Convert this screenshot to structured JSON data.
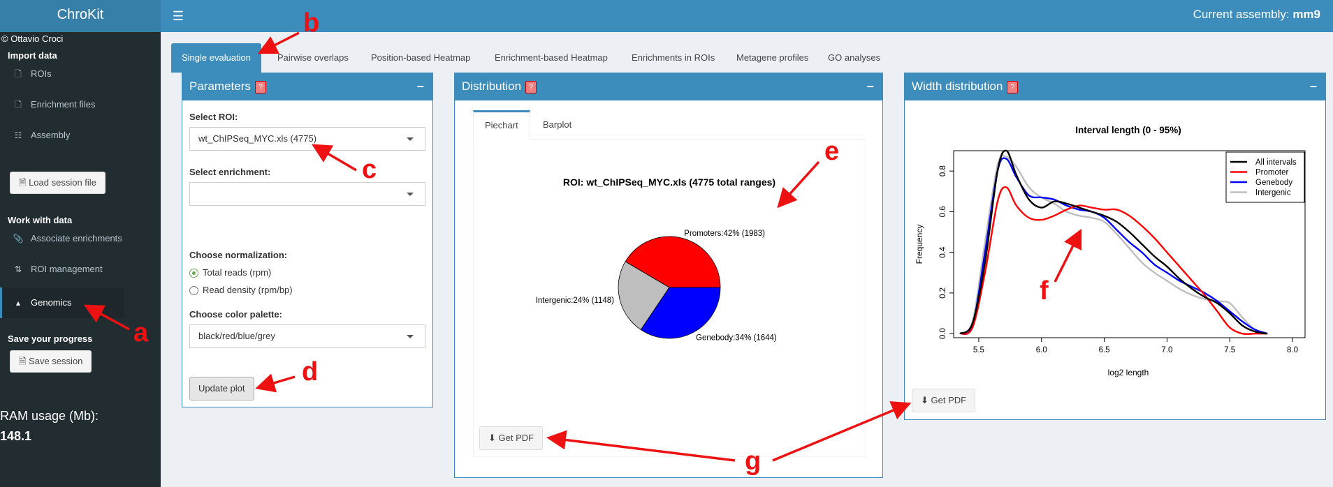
{
  "header": {
    "logo": "ChroKit",
    "assembly_label": "Current assembly:",
    "assembly_value": "mm9"
  },
  "sidebar": {
    "copyright": "© Ottavio Croci",
    "import_header": "Import data",
    "items_import": [
      "ROIs",
      "Enrichment files",
      "Assembly"
    ],
    "load_session": "Load session file",
    "work_header": "Work with data",
    "items_work": [
      "Associate enrichments",
      "ROI management",
      "Genomics"
    ],
    "save_header": "Save your progress",
    "save_session": "Save session",
    "ram_label": "RAM usage (Mb):",
    "ram_value": "148.1"
  },
  "tabs": [
    "Single evaluation",
    "Pairwise overlaps",
    "Position-based Heatmap",
    "Enrichment-based Heatmap",
    "Enrichments in ROIs",
    "Metagene profiles",
    "GO analyses"
  ],
  "parameters": {
    "title": "Parameters",
    "qmark": "?",
    "select_roi_label": "Select ROI:",
    "select_roi_value": "wt_ChIPSeq_MYC.xls (4775)",
    "select_enrichment_label": "Select enrichment:",
    "select_enrichment_value": "",
    "normalization_label": "Choose normalization:",
    "normalization_options": [
      "Total reads (rpm)",
      "Read density (rpm/bp)"
    ],
    "palette_label": "Choose color palette:",
    "palette_value": "black/red/blue/grey",
    "update_button": "Update plot"
  },
  "distribution": {
    "title": "Distribution",
    "qmark": "?",
    "subtabs": [
      "Piechart",
      "Barplot"
    ],
    "get_pdf": "Get PDF"
  },
  "width": {
    "title": "Width distribution",
    "qmark": "?",
    "get_pdf": "Get PDF"
  },
  "annotations": [
    "a",
    "b",
    "c",
    "d",
    "e",
    "f",
    "g"
  ],
  "colors": {
    "header": "#3c8dbc",
    "logo": "#367fa9",
    "sidebar": "#222d32",
    "annotation": "#ee1111"
  },
  "chart_data": [
    {
      "type": "pie",
      "title": "ROI: wt_ChIPSeq_MYC.xls (4775 total ranges)",
      "slices": [
        {
          "label": "Promoters:42% (1983)",
          "value": 1983,
          "color": "#ff0000"
        },
        {
          "label": "Intergenic:24% (1148)",
          "value": 1148,
          "color": "#bebebe"
        },
        {
          "label": "Genebody:34% (1644)",
          "value": 1644,
          "color": "#0000ff"
        }
      ]
    },
    {
      "type": "line",
      "title": "Interval length (0 - 95%)",
      "xlabel": "log2 length",
      "ylabel": "Frequency",
      "xlim": [
        5.3,
        8.1
      ],
      "ylim": [
        -0.02,
        0.9
      ],
      "xticks": [
        "5.5",
        "6.0",
        "6.5",
        "7.0",
        "7.5",
        "8.0"
      ],
      "yticks": [
        "0.0",
        "0.2",
        "0.4",
        "0.6",
        "0.8"
      ],
      "legend_position": "top-right",
      "grid": false,
      "series": [
        {
          "name": "All intervals",
          "color": "#000000",
          "x": [
            5.35,
            5.45,
            5.55,
            5.65,
            5.72,
            5.8,
            5.9,
            6.0,
            6.1,
            6.2,
            6.3,
            6.4,
            6.5,
            6.6,
            6.7,
            6.8,
            6.9,
            7.0,
            7.1,
            7.2,
            7.3,
            7.4,
            7.5,
            7.6,
            7.7,
            7.8
          ],
          "y": [
            0.0,
            0.05,
            0.35,
            0.8,
            0.9,
            0.78,
            0.66,
            0.62,
            0.65,
            0.64,
            0.62,
            0.6,
            0.58,
            0.55,
            0.5,
            0.44,
            0.38,
            0.33,
            0.27,
            0.22,
            0.18,
            0.15,
            0.1,
            0.04,
            0.01,
            0.0
          ]
        },
        {
          "name": "Promoter",
          "color": "#ff0000",
          "x": [
            5.35,
            5.45,
            5.55,
            5.65,
            5.72,
            5.8,
            5.9,
            6.0,
            6.1,
            6.2,
            6.3,
            6.4,
            6.5,
            6.6,
            6.7,
            6.8,
            6.9,
            7.0,
            7.1,
            7.2,
            7.3,
            7.4,
            7.5,
            7.6,
            7.7,
            7.8
          ],
          "y": [
            0.0,
            0.03,
            0.3,
            0.65,
            0.72,
            0.63,
            0.57,
            0.56,
            0.58,
            0.61,
            0.63,
            0.62,
            0.61,
            0.61,
            0.58,
            0.53,
            0.47,
            0.4,
            0.33,
            0.26,
            0.19,
            0.11,
            0.03,
            0.0,
            0.0,
            0.0
          ]
        },
        {
          "name": "Genebody",
          "color": "#0000ff",
          "x": [
            5.35,
            5.45,
            5.55,
            5.65,
            5.72,
            5.8,
            5.9,
            6.0,
            6.1,
            6.2,
            6.3,
            6.4,
            6.5,
            6.6,
            6.7,
            6.8,
            6.9,
            7.0,
            7.1,
            7.2,
            7.3,
            7.4,
            7.5,
            7.6,
            7.7,
            7.8
          ],
          "y": [
            0.0,
            0.04,
            0.4,
            0.8,
            0.86,
            0.77,
            0.68,
            0.67,
            0.66,
            0.63,
            0.61,
            0.6,
            0.57,
            0.51,
            0.45,
            0.4,
            0.34,
            0.3,
            0.26,
            0.23,
            0.2,
            0.16,
            0.11,
            0.06,
            0.02,
            0.0
          ]
        },
        {
          "name": "Intergenic",
          "color": "#bebebe",
          "x": [
            5.35,
            5.45,
            5.55,
            5.65,
            5.72,
            5.8,
            5.9,
            6.0,
            6.1,
            6.2,
            6.3,
            6.4,
            6.5,
            6.6,
            6.7,
            6.8,
            6.9,
            7.0,
            7.1,
            7.2,
            7.3,
            7.4,
            7.5,
            7.6,
            7.7,
            7.8
          ],
          "y": [
            0.0,
            0.06,
            0.45,
            0.83,
            0.87,
            0.82,
            0.72,
            0.67,
            0.64,
            0.6,
            0.58,
            0.57,
            0.55,
            0.49,
            0.42,
            0.35,
            0.3,
            0.26,
            0.22,
            0.19,
            0.17,
            0.16,
            0.15,
            0.08,
            0.02,
            0.0
          ]
        }
      ]
    }
  ]
}
